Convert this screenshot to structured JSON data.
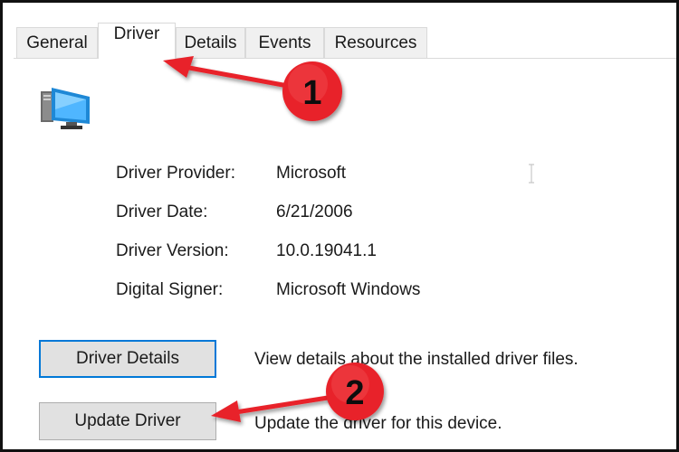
{
  "tabs": [
    {
      "label": "General",
      "active": false
    },
    {
      "label": "Driver",
      "active": true
    },
    {
      "label": "Details",
      "active": false
    },
    {
      "label": "Events",
      "active": false
    },
    {
      "label": "Resources",
      "active": false
    }
  ],
  "device_icon": "computer-monitor-icon",
  "info": [
    {
      "label": "Driver Provider:",
      "value": "Microsoft"
    },
    {
      "label": "Driver Date:",
      "value": "6/21/2006"
    },
    {
      "label": "Driver Version:",
      "value": "10.0.19041.1"
    },
    {
      "label": "Digital Signer:",
      "value": "Microsoft Windows"
    }
  ],
  "buttons": [
    {
      "label": "Driver Details",
      "description": "View details about the installed driver files.",
      "focused": true
    },
    {
      "label": "Update Driver",
      "description": "Update the driver for this device.",
      "focused": false
    }
  ],
  "annotations": [
    {
      "number": "1",
      "color": "#e8232a"
    },
    {
      "number": "2",
      "color": "#e8232a"
    }
  ]
}
